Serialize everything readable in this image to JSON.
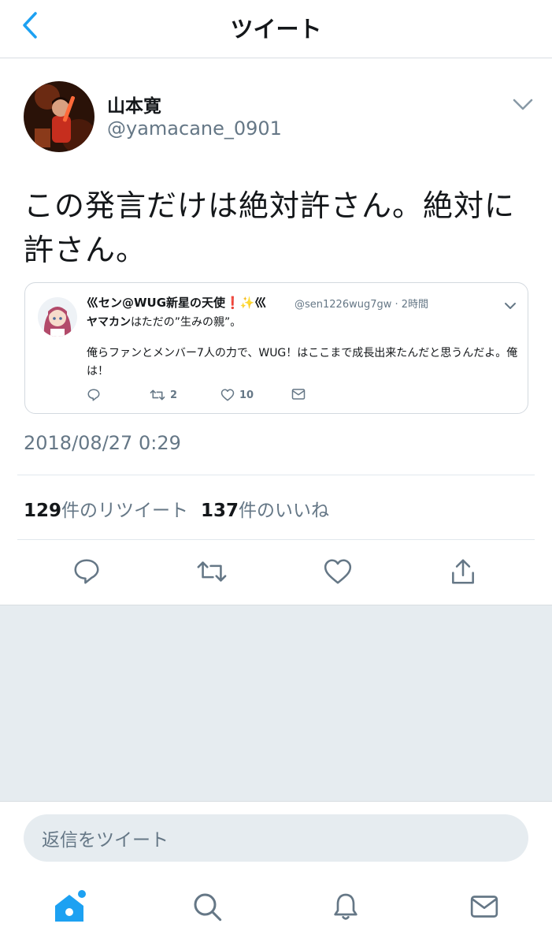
{
  "header": {
    "title": "ツイート",
    "back_icon": "chevron-left-icon"
  },
  "tweet": {
    "author_name": "山本寛",
    "author_handle": "@yamacane_0901",
    "text_line1": "この発言だけは絶対許さん。絶対に",
    "text_line2": "許さん。",
    "timestamp": "2018/08/27 0:29",
    "retweets_count": "129",
    "retweets_label": "件のリツイート",
    "likes_count": "137",
    "likes_label": "件のいいね"
  },
  "quote": {
    "name": "巛セン@WUG新星の天使❗✨巛",
    "handle": "@sen1226wug7gw",
    "time": "· 2時間",
    "line1_bold": "ヤマカン",
    "line1_rest": "はただの”生みの親”。",
    "line2": "俺らファンとメンバー7人の力で、WUG！はここまで成長出来たんだと思うんだよ。俺は！",
    "retweets": "2",
    "likes": "10"
  },
  "reply": {
    "placeholder": "返信をツイート"
  },
  "tabs": [
    "home-icon",
    "search-icon",
    "notifications-icon",
    "messages-icon"
  ],
  "colors": {
    "accent": "#1da1f2",
    "text": "#14171a",
    "secondary": "#657786",
    "background_gray": "#e6ecf0"
  }
}
